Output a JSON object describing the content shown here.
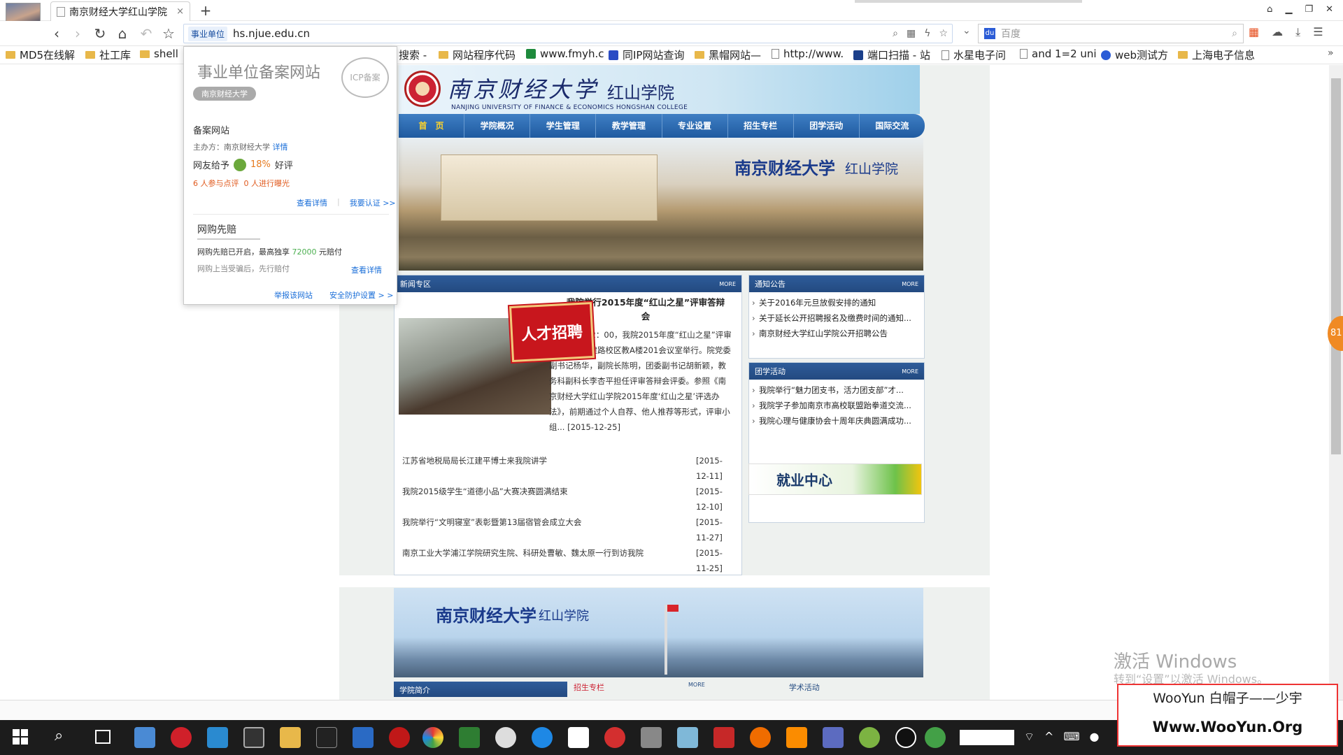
{
  "browser": {
    "tab_title": "南京财经大学红山学院",
    "tab_close": "×",
    "new_tab": "+",
    "url_badge": "事业单位",
    "url": "hs.njue.edu.cn",
    "search_placeholder": "百度",
    "search_badge": "du"
  },
  "bookmarks": [
    {
      "label": "MD5在线解",
      "icon": "folder"
    },
    {
      "label": "社工库",
      "icon": "folder"
    },
    {
      "label": "shell",
      "icon": "folder"
    },
    {
      "label": "搜索 -",
      "icon": "none"
    },
    {
      "label": "网站程序代码",
      "icon": "folder"
    },
    {
      "label": "www.fmyh.c",
      "icon": "site"
    },
    {
      "label": "同IP网站查询",
      "icon": "site"
    },
    {
      "label": "黑帽网站—",
      "icon": "folder"
    },
    {
      "label": "http://www.",
      "icon": "page"
    },
    {
      "label": "端口扫描 - 站",
      "icon": "site"
    },
    {
      "label": "水星电子问",
      "icon": "page"
    },
    {
      "label": "and 1=2 uni",
      "icon": "page"
    },
    {
      "label": "web测试方",
      "icon": "site"
    },
    {
      "label": "上海电子信息",
      "icon": "folder"
    }
  ],
  "popup": {
    "title": "事业单位备案网站",
    "seal": "ICP备案",
    "tag": "南京财经大学",
    "label": "备案网站",
    "host_prefix": "主办方：南京财经大学",
    "host_link": "详情",
    "rate_prefix": "网友给予",
    "rate_pct": "18%",
    "rate_suffix": "好评",
    "count_a": "6 人参与点评",
    "count_b": "0 人进行曝光",
    "link_details": "查看详情",
    "link_certify": "我要认证 >>",
    "section": "网购先赔",
    "line1_pre": "网购先赔已开启，最高独享",
    "line1_amt": "72000",
    "line1_suf": "元赔付",
    "line2": "网购上当受骗后，先行赔付",
    "line2_link": "查看详情",
    "report": "举报该网站",
    "settings": "安全防护设置 > >"
  },
  "site": {
    "name_cn": "南京财经大学",
    "college_cn": "红山学院",
    "name_en": "NANJING UNIVERSITY OF FINANCE & ECONOMICS    HONGSHAN COLLEGE",
    "nav": [
      "首　页",
      "学院概况",
      "学生管理",
      "教学管理",
      "专业设置",
      "招生专栏",
      "团学活动",
      "国际交流"
    ],
    "banner_title": "南京财经大学",
    "banner_sub": "红山学院",
    "news": {
      "section": "新闻专区",
      "more": "MORE",
      "headline": "我院举行2015年度“红山之星”评审答辩会",
      "body": "12月24日12：00，我院2015年度“红山之星”评审答辩会在福建路校区教A楼201会议室举行。院党委副书记杨华，副院长陈明，团委副书记胡新颖，教务科副科长李杏平担任评审答辩会评委。参照《南京财经大学红山学院2015年度‘红山之星’评选办法》，前期通过个人自荐、他人推荐等形式，评审小组... [2015-12-25]",
      "items": [
        {
          "title": "江苏省地税局局长江建平博士来我院讲学",
          "date": "[2015-12-11]"
        },
        {
          "title": "我院2015级学生“道德小品”大赛决赛圆满结束",
          "date": "[2015-12-10]"
        },
        {
          "title": "我院举行“文明寝室”表彰暨第13届宿管会成立大会",
          "date": "[2015-11-27]"
        },
        {
          "title": "南京工业大学浦江学院研究生院、科研处曹敏、魏太原一行到访我院",
          "date": "[2015-11-25]"
        }
      ]
    },
    "recruit": "人才招聘",
    "notice": {
      "section": "通知公告",
      "more": "MORE",
      "items": [
        "关于2016年元旦放假安排的通知",
        "关于延长公开招聘报名及缴费时间的通知...",
        "南京财经大学红山学院公开招聘公告"
      ]
    },
    "activity": {
      "section": "团学活动",
      "more": "MORE",
      "items": [
        "我院举行“魅力团支书，活力团支部”才...",
        "我院学子参加南京市高校联盟跆拳道交流...",
        "我院心理与健康协会十周年庆典圆满成功..."
      ]
    },
    "jiuye": "就业中心",
    "low_title": "南京财经大学",
    "low_sub": "红山学院",
    "low_sec1": "学院简介",
    "low_sec2": "招生专栏",
    "low_more": "MORE",
    "low_sec3": "学术活动"
  },
  "watermark": {
    "activate": "激活 Windows",
    "activate_sub": "转到“设置”以激活 Windows。",
    "woo_line1": "WooYun 白帽子——少宇",
    "woo_line2": "Www.WooYun.Org"
  },
  "side_badge": "81"
}
